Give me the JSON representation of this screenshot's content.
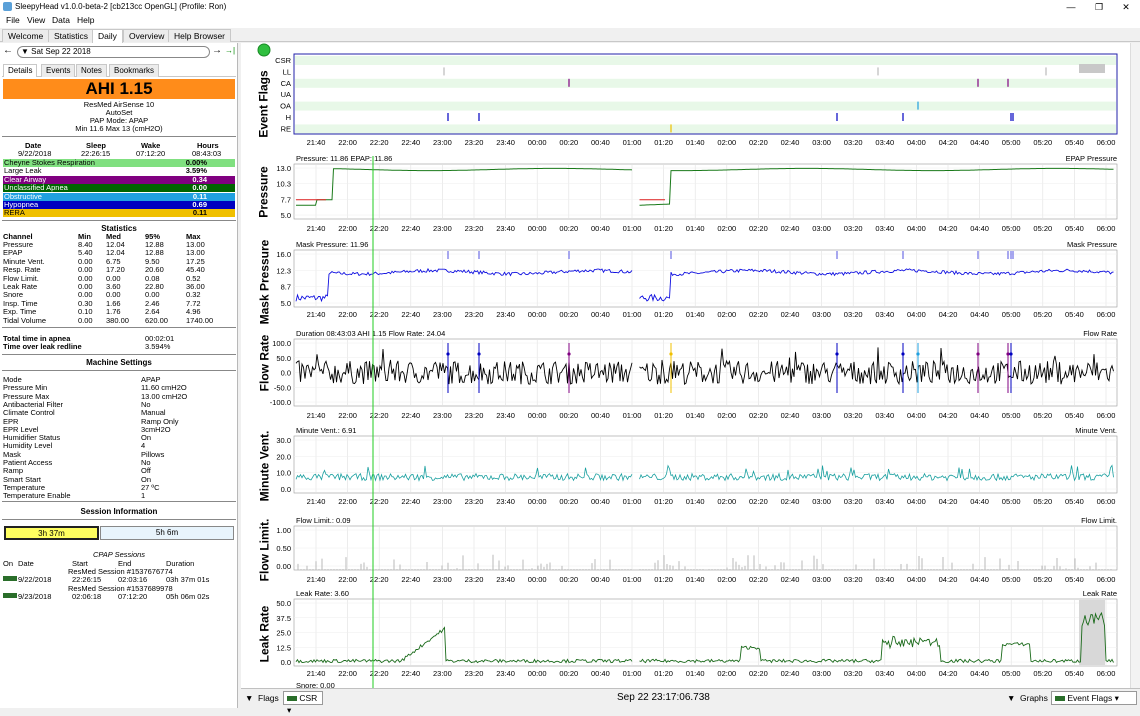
{
  "window": {
    "title": "SleepyHead v1.0.0-beta-2 [cb213cc OpenGL] (Profile: Ron)",
    "minimize": "—",
    "maximize": "❐",
    "close": "✕"
  },
  "menu": [
    "File",
    "View",
    "Data",
    "Help"
  ],
  "tabs": [
    "Welcome",
    "Statistics",
    "Daily",
    "Overview",
    "Help Browser"
  ],
  "active_tab": "Daily",
  "left": {
    "date": "Sat Sep 22 2018",
    "nav": {
      "prev": "←",
      "next": "→",
      "last": "→|"
    },
    "subtabs": [
      "Details",
      "Events",
      "Notes",
      "Bookmarks"
    ],
    "ahi_label": "AHI 1.15",
    "machine": "ResMed AirSense 10",
    "machine_mode": "AutoSet",
    "pap_mode": "PAP Mode: APAP",
    "pressure_range": "Min 11.6 Max 13 (cmH2O)",
    "summary": {
      "headers": [
        "Date",
        "Sleep",
        "Wake",
        "Hours"
      ],
      "values": [
        "9/22/2018",
        "22:26:15",
        "07:12:20",
        "08:43:03"
      ]
    },
    "indices": [
      {
        "label": "Cheyne Stokes Respiration",
        "value": "0.00%",
        "color": "#80e080",
        "text": "#000"
      },
      {
        "label": "Large Leak",
        "value": "3.59%",
        "color": "#ffffff",
        "text": "#000"
      },
      {
        "label": "Clear Airway",
        "value": "0.34",
        "color": "#800080",
        "text": "#fff"
      },
      {
        "label": "Unclassified Apnea",
        "value": "0.00",
        "color": "#006400",
        "text": "#fff"
      },
      {
        "label": "Obstructive",
        "value": "0.11",
        "color": "#20a0e0",
        "text": "#fff"
      },
      {
        "label": "Hypopnea",
        "value": "0.69",
        "color": "#0000c0",
        "text": "#fff"
      },
      {
        "label": "RERA",
        "value": "0.11",
        "color": "#f0c000",
        "text": "#000"
      }
    ],
    "stats_title": "Statistics",
    "stats_headers": [
      "Channel",
      "Min",
      "Med",
      "95%",
      "Max"
    ],
    "stats": [
      [
        "Pressure",
        "8.40",
        "12.04",
        "12.88",
        "13.00"
      ],
      [
        "EPAP",
        "5.40",
        "12.04",
        "12.88",
        "13.00"
      ],
      [
        "Minute Vent.",
        "0.00",
        "6.75",
        "9.50",
        "17.25"
      ],
      [
        "Resp. Rate",
        "0.00",
        "17.20",
        "20.60",
        "45.40"
      ],
      [
        "Flow Limit.",
        "0.00",
        "0.00",
        "0.08",
        "0.52"
      ],
      [
        "Leak Rate",
        "0.00",
        "3.60",
        "22.80",
        "36.00"
      ],
      [
        "Snore",
        "0.00",
        "0.00",
        "0.00",
        "0.32"
      ],
      [
        "Insp. Time",
        "0.30",
        "1.66",
        "2.46",
        "7.72"
      ],
      [
        "Exp. Time",
        "0.10",
        "1.76",
        "2.64",
        "4.96"
      ],
      [
        "Tidal Volume",
        "0.00",
        "380.00",
        "620.00",
        "1740.00"
      ]
    ],
    "totals": [
      {
        "label": "Total time in apnea",
        "value": "00:02:01"
      },
      {
        "label": "Time over leak redline",
        "value": "3.594%"
      }
    ],
    "machine_settings_title": "Machine Settings",
    "settings": [
      [
        "Mode",
        "APAP"
      ],
      [
        "Pressure Min",
        "11.60 cmH2O"
      ],
      [
        "Pressure Max",
        "13.00 cmH2O"
      ],
      [
        "Antibacterial Filter",
        "No"
      ],
      [
        "Climate Control",
        "Manual"
      ],
      [
        "EPR",
        "Ramp Only"
      ],
      [
        "EPR Level",
        "3cmH2O"
      ],
      [
        "Humidifier Status",
        "On"
      ],
      [
        "Humidity Level",
        "4"
      ],
      [
        "Mask",
        "Pillows"
      ],
      [
        "Patient Access",
        "No"
      ],
      [
        "Ramp",
        "Off"
      ],
      [
        "Smart Start",
        "On"
      ],
      [
        "Temperature",
        "27 ºC"
      ],
      [
        "Temperature Enable",
        "1"
      ]
    ],
    "session_info_title": "Session Information",
    "session_bars": [
      "3h 37m",
      "5h 6m"
    ],
    "cpap_sessions_title": "CPAP Sessions",
    "session_headers": [
      "On",
      "Date",
      "Start",
      "End",
      "Duration"
    ],
    "sessions": [
      {
        "name": "ResMed Session #1537676774",
        "date": "9/22/2018",
        "start": "22:26:15",
        "end": "02:03:16",
        "duration": "03h 37m 01s"
      },
      {
        "name": "ResMed Session #1537689978",
        "date": "9/23/2018",
        "start": "02:06:18",
        "end": "07:12:20",
        "duration": "05h 06m 02s"
      }
    ]
  },
  "graphs": {
    "time_ticks": [
      "21:40",
      "22:00",
      "22:20",
      "22:40",
      "23:00",
      "23:20",
      "23:40",
      "00:00",
      "00:20",
      "00:40",
      "01:00",
      "01:20",
      "01:40",
      "02:00",
      "02:20",
      "02:40",
      "03:00",
      "03:20",
      "03:40",
      "04:00",
      "04:20",
      "04:40",
      "05:00",
      "05:20",
      "05:40",
      "06:00"
    ],
    "event_flags": {
      "title": "Event Flags",
      "rows": [
        "CSR",
        "LL",
        "CA",
        "UA",
        "OA",
        "H",
        "RE"
      ]
    },
    "pressure": {
      "title": "Pressure",
      "header": "Pressure: 11.86 EPAP: 11.86",
      "legend": "EPAP  Pressure",
      "yticks": [
        "13.0",
        "10.3",
        "7.7",
        "5.0"
      ]
    },
    "mask_pressure": {
      "title": "Mask Pressure",
      "header": "Mask Pressure: 11.96",
      "legend": "Mask Pressure",
      "yticks": [
        "16.0",
        "12.3",
        "8.7",
        "5.0"
      ]
    },
    "flow_rate": {
      "title": "Flow Rate",
      "header": "Duration 08:43:03 AHI 1.15 Flow Rate: 24.04",
      "legend": "Flow Rate",
      "yticks": [
        "100.0",
        "50.0",
        "0.0",
        "-50.0",
        "-100.0"
      ]
    },
    "minute_vent": {
      "title": "Minute Vent.",
      "header": "Minute Vent.: 6.91",
      "legend": "Minute Vent.",
      "yticks": [
        "30.0",
        "20.0",
        "10.0",
        "0.0"
      ]
    },
    "flow_limit": {
      "title": "Flow Limit.",
      "header": "Flow Limit.: 0.09",
      "legend": "Flow Limit.",
      "yticks": [
        "1.00",
        "0.50",
        "0.00"
      ]
    },
    "leak_rate": {
      "title": "Leak Rate",
      "header": "Leak Rate: 3.60",
      "legend": "Leak Rate",
      "yticks": [
        "50.0",
        "37.5",
        "25.0",
        "12.5",
        "0.0"
      ]
    },
    "snore_partial": "Snore: 0.00"
  },
  "footer": {
    "flags_label": "Flags",
    "flags_value": "CSR",
    "timestamp": "Sep 22 23:17:06.738",
    "graphs_label": "Graphs",
    "graphs_value": "Event Flags"
  }
}
